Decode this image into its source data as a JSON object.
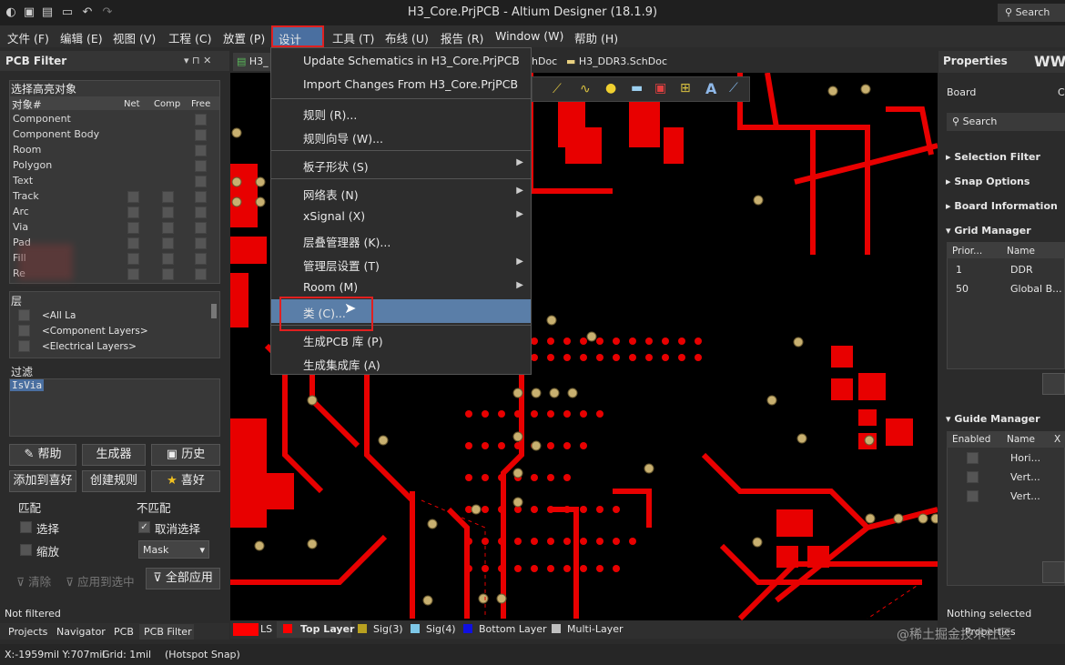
{
  "window": {
    "title": "H3_Core.PrjPCB - Altium Designer (18.1.9)",
    "search": "Search"
  },
  "menubar": [
    "文件 (F)",
    "编辑 (E)",
    "视图 (V)",
    "工程 (C)",
    "放置 (P)",
    "设计 (D)",
    "工具 (T)",
    "布线 (U)",
    "报告 (R)",
    "Window (W)",
    "帮助 (H)"
  ],
  "doc_tabs": [
    "H3_",
    "hDoc",
    "H3_DDR3.SchDoc"
  ],
  "design_menu": {
    "items": [
      {
        "label": "Update Schematics in H3_Core.PrjPCB",
        "sub": false
      },
      {
        "label": "Import Changes From H3_Core.PrjPCB",
        "sub": false
      },
      {
        "label": "规则 (R)...",
        "sub": false
      },
      {
        "label": "规则向导 (W)...",
        "sub": false
      },
      {
        "label": "板子形状 (S)",
        "sub": true
      },
      {
        "label": "网络表 (N)",
        "sub": true
      },
      {
        "label": "xSignal (X)",
        "sub": true
      },
      {
        "label": "层叠管理器 (K)...",
        "sub": false
      },
      {
        "label": "管理层设置 (T)",
        "sub": true
      },
      {
        "label": "Room (M)",
        "sub": true
      },
      {
        "label": "类 (C)...",
        "sub": false
      },
      {
        "label": "生成PCB 库 (P)",
        "sub": false
      },
      {
        "label": "生成集成库 (A)",
        "sub": false
      }
    ],
    "highlighted": "类 (C)..."
  },
  "pcb_filter": {
    "title": "PCB Filter",
    "pin_icons": "▾ ⊓ ✕",
    "highlight_label": "选择高亮对象",
    "columns": [
      "对象#",
      "Net",
      "Comp",
      "Free"
    ],
    "objects": [
      "Component",
      "Component Body",
      "Room",
      "Polygon",
      "Text",
      "Track",
      "Arc",
      "Via",
      "Pad",
      "Fill",
      "Re"
    ],
    "layers_label": "层",
    "layers": [
      "<All La",
      "<Component Layers>",
      "<Electrical Layers>"
    ],
    "filter_label": "过滤",
    "filter_value": "IsVia",
    "buttons": {
      "help": "帮助",
      "builder": "生成器",
      "history": "历史",
      "add_fav": "添加到喜好",
      "create_rule": "创建规则",
      "favorites": "喜好"
    },
    "match_label": "匹配",
    "nomatch_label": "不匹配",
    "select_label": "选择",
    "zoom_label": "缩放",
    "deselect_label": "取消选择",
    "mask_label": "Mask",
    "clear_label": "清除",
    "apply_sel_label": "应用到选中",
    "apply_all_label": "全部应用",
    "status": "Not filtered"
  },
  "bottom_tabs": [
    "Projects",
    "Navigator",
    "PCB",
    "PCB Filter"
  ],
  "layers_bar": [
    {
      "label": "LS",
      "color": "#ff0000"
    },
    {
      "label": "Top Layer",
      "color": "#ff0000"
    },
    {
      "label": "Sig(3)",
      "color": "#b8a020"
    },
    {
      "label": "Sig(4)",
      "color": "#7ec8e8"
    },
    {
      "label": "Bottom Layer",
      "color": "#1010e0"
    },
    {
      "label": "Multi-Layer",
      "color": "#c0c0c0"
    }
  ],
  "properties": {
    "title": "Properties",
    "header_right": "WW",
    "board": "Board",
    "board_c": "C",
    "search": "Search",
    "sections": [
      "Selection Filter",
      "Snap Options",
      "Board Information",
      "Grid Manager"
    ],
    "grid_cols": [
      "Prior...",
      "Name"
    ],
    "grid_rows": [
      [
        "1",
        "DDR"
      ],
      [
        "50",
        "Global B..."
      ]
    ],
    "guide": "Guide Manager",
    "guide_cols": [
      "Enabled",
      "Name",
      "X"
    ],
    "guide_rows": [
      "Hori...",
      "Vert...",
      "Vert..."
    ],
    "nothing": "Nothing selected",
    "bottom_tabs": "Properties",
    "watermark": "@稀土掘金技术社区"
  },
  "status": {
    "coords": "X:-1959mil Y:707mil",
    "grid": "Grid: 1mil",
    "snap": "(Hotspot Snap)"
  }
}
